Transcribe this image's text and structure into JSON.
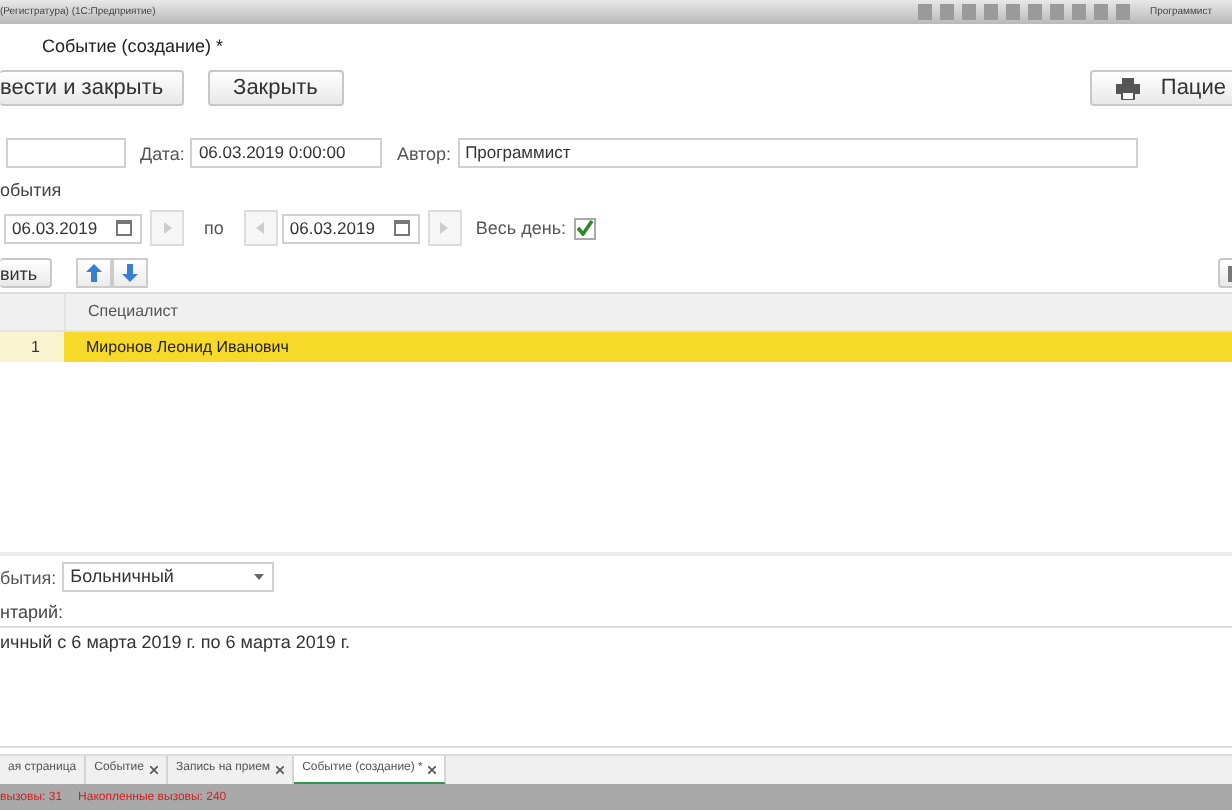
{
  "app_title_bar": {
    "title": "(Регистратура) (1С:Предприятие)",
    "user": "Программист"
  },
  "form_title": "Событие (создание) *",
  "command_bar": {
    "buttons": [
      "вести и закрыть",
      "Закрыть"
    ],
    "print_button": "Пацие"
  },
  "header_fields": {
    "date_label": "Дата:",
    "date": "06.03.2019  0:00:00",
    "author_label": "Автор:",
    "author": "Программист"
  },
  "period": {
    "label": "обытия",
    "from": "06.03.2019",
    "to_label": "по",
    "to": "06.03.2019",
    "all_day_label": "Весь день:",
    "all_day": true
  },
  "table_toolbar": {
    "add_button": "вить"
  },
  "table": {
    "columns": [
      "",
      "Специалист"
    ],
    "rows": [
      {
        "cells": [
          "1",
          "Миронов Леонид Иванович"
        ],
        "selected": true
      }
    ]
  },
  "event_type": {
    "label": "бытия:",
    "value": "Больничный"
  },
  "comment": {
    "label": "нтарий:",
    "value": "ичный с 6 марта 2019 г. по 6 марта 2019 г."
  },
  "open_tabs": [
    {
      "label": "ая страница",
      "closable": false,
      "selected": false
    },
    {
      "label": "Событие",
      "closable": true,
      "selected": false
    },
    {
      "label": "Запись на прием",
      "closable": true,
      "selected": false
    },
    {
      "label": "Событие (создание) *",
      "closable": true,
      "selected": true
    }
  ],
  "status_bar": [
    "вызовы: 31",
    "Накопленные вызовы: 240"
  ]
}
